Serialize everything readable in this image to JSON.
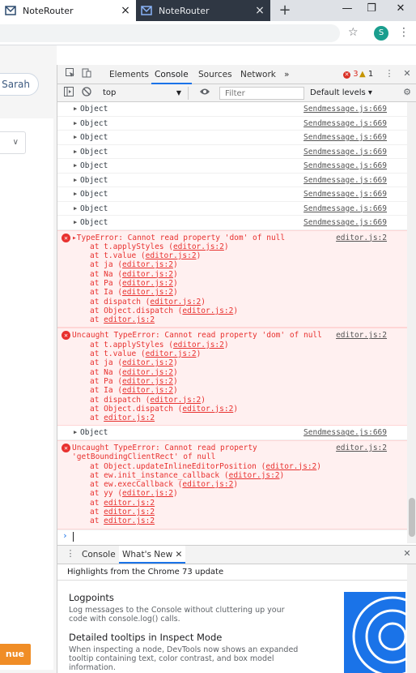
{
  "browser": {
    "tabs": [
      {
        "title": "NoteRouter",
        "active": true
      },
      {
        "title": "NoteRouter",
        "active": false
      }
    ],
    "new_tab": "+",
    "avatar_letter": "S"
  },
  "page": {
    "user_pill": "Sarah",
    "continue_label": "nue"
  },
  "devtools": {
    "tabs": [
      "Elements",
      "Console",
      "Sources",
      "Network"
    ],
    "more_tabs": "»",
    "error_count": "3",
    "warning_count": "1",
    "context": "top",
    "filter_placeholder": "Filter",
    "levels": "Default levels ▾",
    "object_rows": [
      {
        "text": "Object",
        "source": "Sendmessage.js:669"
      },
      {
        "text": "Object",
        "source": "Sendmessage.js:669"
      },
      {
        "text": "Object",
        "source": "Sendmessage.js:669"
      },
      {
        "text": "Object",
        "source": "Sendmessage.js:669"
      },
      {
        "text": "Object",
        "source": "Sendmessage.js:669"
      },
      {
        "text": "Object",
        "source": "Sendmessage.js:669"
      },
      {
        "text": "Object",
        "source": "Sendmessage.js:669"
      },
      {
        "text": "Object",
        "source": "Sendmessage.js:669"
      },
      {
        "text": "Object",
        "source": "Sendmessage.js:669"
      }
    ],
    "error1": {
      "message": "▸TypeError: Cannot read property 'dom' of null",
      "source": "editor.js:2",
      "stack": [
        [
          "at t.applyStyles (",
          "editor.js:2",
          ")"
        ],
        [
          "at t.value (",
          "editor.js:2",
          ")"
        ],
        [
          "at ja (",
          "editor.js:2",
          ")"
        ],
        [
          "at Na (",
          "editor.js:2",
          ")"
        ],
        [
          "at Pa (",
          "editor.js:2",
          ")"
        ],
        [
          "at Ia (",
          "editor.js:2",
          ")"
        ],
        [
          "at dispatch (",
          "editor.js:2",
          ")"
        ],
        [
          "at Object.dispatch (",
          "editor.js:2",
          ")"
        ],
        [
          "at ",
          "editor.js:2",
          ""
        ]
      ]
    },
    "error2": {
      "message": "Uncaught TypeError: Cannot read property 'dom' of null",
      "source": "editor.js:2",
      "stack": [
        [
          "at t.applyStyles (",
          "editor.js:2",
          ")"
        ],
        [
          "at t.value (",
          "editor.js:2",
          ")"
        ],
        [
          "at ja (",
          "editor.js:2",
          ")"
        ],
        [
          "at Na (",
          "editor.js:2",
          ")"
        ],
        [
          "at Pa (",
          "editor.js:2",
          ")"
        ],
        [
          "at Ia (",
          "editor.js:2",
          ")"
        ],
        [
          "at dispatch (",
          "editor.js:2",
          ")"
        ],
        [
          "at Object.dispatch (",
          "editor.js:2",
          ")"
        ],
        [
          "at ",
          "editor.js:2",
          ""
        ]
      ]
    },
    "object_row_after": {
      "text": "Object",
      "source": "Sendmessage.js:669"
    },
    "error3": {
      "message": "Uncaught TypeError: Cannot read property\n'getBoundingClientRect' of null",
      "source": "editor.js:2",
      "stack": [
        [
          "at Object.updateInlineEditorPosition (",
          "editor.js:2",
          ")"
        ],
        [
          "at ew.init_instance_callback (",
          "editor.js:2",
          ")"
        ],
        [
          "at ew.execCallback (",
          "editor.js:2",
          ")"
        ],
        [
          "at yy (",
          "editor.js:2",
          ")"
        ],
        [
          "at ",
          "editor.js:2",
          ""
        ],
        [
          "at ",
          "editor.js:2",
          ""
        ],
        [
          "at ",
          "editor.js:2",
          ""
        ]
      ]
    },
    "prompt": "›",
    "drawer": {
      "tabs": [
        "Console",
        "What's New"
      ],
      "header": "Highlights from the Chrome 73 update",
      "items": [
        {
          "title": "Logpoints",
          "desc": "Log messages to the Console without cluttering up your code with console.log() calls."
        },
        {
          "title": "Detailed tooltips in Inspect Mode",
          "desc": "When inspecting a node, DevTools now shows an expanded tooltip containing text, color contrast, and box model information."
        }
      ]
    }
  }
}
